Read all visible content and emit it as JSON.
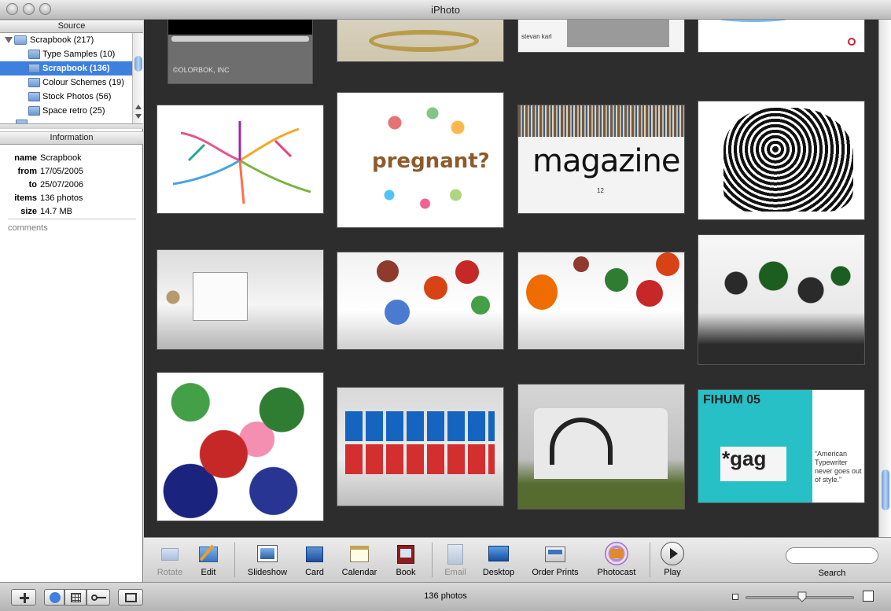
{
  "window": {
    "title": "iPhoto"
  },
  "source_pane": {
    "header": "Source",
    "items": [
      {
        "label": "Scrapbook (217)",
        "kind": "folder",
        "expanded": true
      },
      {
        "label": "Type Samples (10)",
        "kind": "album"
      },
      {
        "label": "Scrapbook (136)",
        "kind": "album",
        "selected": true
      },
      {
        "label": "Colour Schemes (19)",
        "kind": "album"
      },
      {
        "label": "Stock Photos (56)",
        "kind": "album"
      },
      {
        "label": "Space retro (25)",
        "kind": "album"
      }
    ]
  },
  "info_pane": {
    "header": "Information",
    "rows": [
      {
        "key": "name",
        "value": "Scrapbook"
      },
      {
        "key": "from",
        "value": "17/05/2005"
      },
      {
        "key": "to",
        "value": "25/07/2006"
      },
      {
        "key": "items",
        "value": "136 photos"
      },
      {
        "key": "size",
        "value": "14.7 MB"
      }
    ],
    "comments_placeholder": "comments"
  },
  "photo_grid": {
    "thumbnails": [
      {
        "caption": "©OLORBOK, INC",
        "scene": "video-player"
      },
      {
        "scene": "gold-wreath"
      },
      {
        "caption": "stevan karl",
        "scene": "print-page"
      },
      {
        "scene": "leaflet"
      },
      {
        "scene": "colour-tree-map"
      },
      {
        "caption": "pregnant?",
        "scene": "illustration-tree"
      },
      {
        "caption": "magazine",
        "caption_small": "12",
        "scene": "magazine-cover"
      },
      {
        "scene": "patterned-elephant"
      },
      {
        "scene": "gallery-white"
      },
      {
        "scene": "gallery-colour-1"
      },
      {
        "scene": "gallery-colour-2"
      },
      {
        "scene": "gallery-black"
      },
      {
        "scene": "floral-graphic"
      },
      {
        "scene": "gallery-prints"
      },
      {
        "scene": "painted-barn"
      },
      {
        "caption": "FIHUM 05",
        "caption_small": "*gag",
        "quote": "“American Typewriter never goes out of style.”",
        "scene": "poster"
      }
    ]
  },
  "toolbar": {
    "tools": [
      {
        "label": "Rotate",
        "icon": "rotate-icon",
        "disabled": true
      },
      {
        "label": "Edit",
        "icon": "edit-icon"
      },
      {
        "label": "Slideshow",
        "icon": "slideshow-icon"
      },
      {
        "label": "Card",
        "icon": "card-icon"
      },
      {
        "label": "Calendar",
        "icon": "calendar-icon"
      },
      {
        "label": "Book",
        "icon": "book-icon"
      },
      {
        "label": "Email",
        "icon": "email-icon",
        "disabled": true
      },
      {
        "label": "Desktop",
        "icon": "desktop-icon"
      },
      {
        "label": "Order Prints",
        "icon": "order-prints-icon"
      },
      {
        "label": "Photocast",
        "icon": "photocast-icon"
      },
      {
        "label": "Play",
        "icon": "play-icon"
      }
    ],
    "search": {
      "label": "Search",
      "value": ""
    }
  },
  "bottom_bar": {
    "photo_count": "136 photos",
    "zoom_level": 0.52
  },
  "colors": {
    "selection": "#3d80df",
    "grid_background": "#2d2d2d"
  }
}
